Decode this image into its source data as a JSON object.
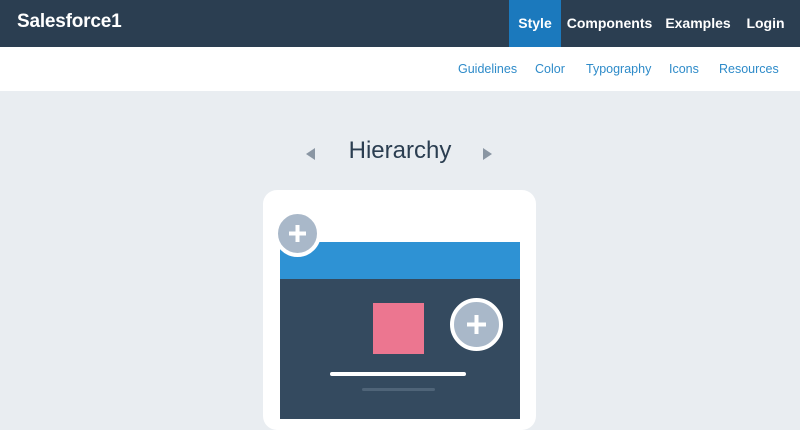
{
  "header": {
    "brand": "Salesforce1",
    "nav": [
      {
        "label": "Style",
        "active": true
      },
      {
        "label": "Components",
        "active": false
      },
      {
        "label": "Examples",
        "active": false
      },
      {
        "label": "Login",
        "active": false
      }
    ]
  },
  "subnav": {
    "items": [
      {
        "label": "Guidelines"
      },
      {
        "label": "Color"
      },
      {
        "label": "Typography"
      },
      {
        "label": "Icons"
      },
      {
        "label": "Resources"
      }
    ]
  },
  "main": {
    "title": "Hierarchy",
    "prev_icon": "triangle-left-icon",
    "next_icon": "triangle-right-icon",
    "illustration": {
      "action_icon": "plus-icon"
    }
  },
  "colors": {
    "topbar": "#2b3e51",
    "active_nav": "#1b79bd",
    "link": "#2e8bc9",
    "page_bg": "#e9edf1",
    "screen_header": "#2e92d4",
    "screen_body": "#344a5f",
    "accent_square": "#ec7690",
    "plus_button": "#a9b8c9"
  }
}
